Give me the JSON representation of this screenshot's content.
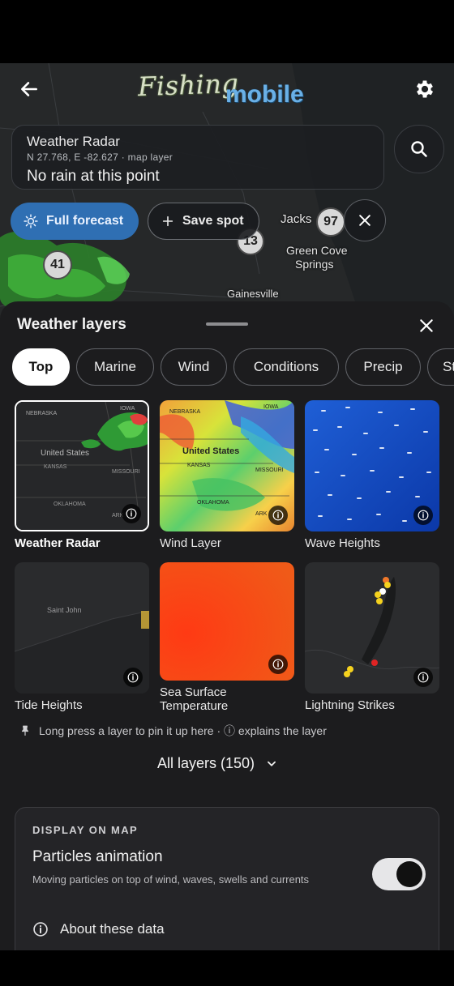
{
  "app": {
    "logo_word1": "Fishing",
    "logo_word2": "mobile"
  },
  "info_card": {
    "title": "Weather Radar",
    "coords": "N 27.768, E -82.627 · map layer",
    "status": "No rain at this point"
  },
  "actions": {
    "full_forecast": "Full forecast",
    "save_spot": "Save spot"
  },
  "map": {
    "labels": {
      "jacks": "Jacks",
      "green_cove": "Green Cove",
      "springs": "Springs",
      "gainesville": "Gainesville"
    },
    "shields": {
      "i97": "97",
      "i13": "13",
      "i41": "41"
    }
  },
  "sheet": {
    "title": "Weather layers",
    "tabs": [
      "Top",
      "Marine",
      "Wind",
      "Conditions",
      "Precip",
      "St"
    ],
    "layers": [
      {
        "name": "Weather Radar",
        "map_text": {
          "a": "NEBRASKA",
          "b": "IOWA",
          "c": "United States",
          "d": "KANSAS",
          "e": "MISSOURI",
          "f": "OKLAHOMA",
          "g": "ARK"
        }
      },
      {
        "name": "Wind Layer",
        "map_text": {
          "a": "NEBRASKA",
          "b": "IOWA",
          "c": "United States",
          "d": "KANSAS",
          "e": "MISSOURI",
          "f": "OKLAHOMA",
          "g": "ARK"
        }
      },
      {
        "name": "Wave Heights"
      },
      {
        "name": "Tide Heights",
        "map_text": {
          "a": "Saint John"
        }
      },
      {
        "name": "Sea Surface Temperature"
      },
      {
        "name": "Lightning Strikes"
      }
    ],
    "hint": "Long press a layer to pin it up here · ⓘ explains the layer",
    "all_layers": "All layers (150)",
    "display": {
      "caption": "DISPLAY ON MAP",
      "particles_title": "Particles animation",
      "particles_desc": "Moving particles on top of wind, waves, swells and currents",
      "particles_enabled": true,
      "about": "About these data"
    }
  },
  "colors": {
    "accent": "#2f6fb3",
    "sheet_bg": "#1c1c1e",
    "card_bg": "#242427"
  }
}
